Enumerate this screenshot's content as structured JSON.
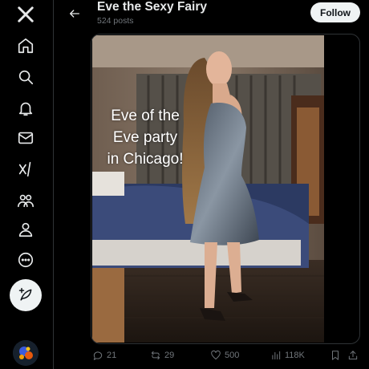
{
  "sidebar": {
    "items": [
      {
        "name": "x-logo-icon"
      },
      {
        "name": "home-icon"
      },
      {
        "name": "explore-icon"
      },
      {
        "name": "notifications-icon"
      },
      {
        "name": "messages-icon"
      },
      {
        "name": "grok-icon"
      },
      {
        "name": "communities-icon"
      },
      {
        "name": "profile-icon"
      },
      {
        "name": "more-icon"
      }
    ],
    "post_button": "compose-post-icon"
  },
  "header": {
    "title": "Eve the Sexy Fairy",
    "subtitle": "524 posts",
    "follow_label": "Follow"
  },
  "media": {
    "caption_lines": [
      "Eve of the",
      "Eve party",
      "in Chicago!"
    ]
  },
  "actions": {
    "replies": "21",
    "reposts": "29",
    "likes": "500",
    "views": "118K"
  },
  "colors": {
    "background": "#000000",
    "text": "#e7e9ea",
    "muted": "#71767b",
    "border": "#2f3336",
    "button_bg": "#eff3f4"
  }
}
